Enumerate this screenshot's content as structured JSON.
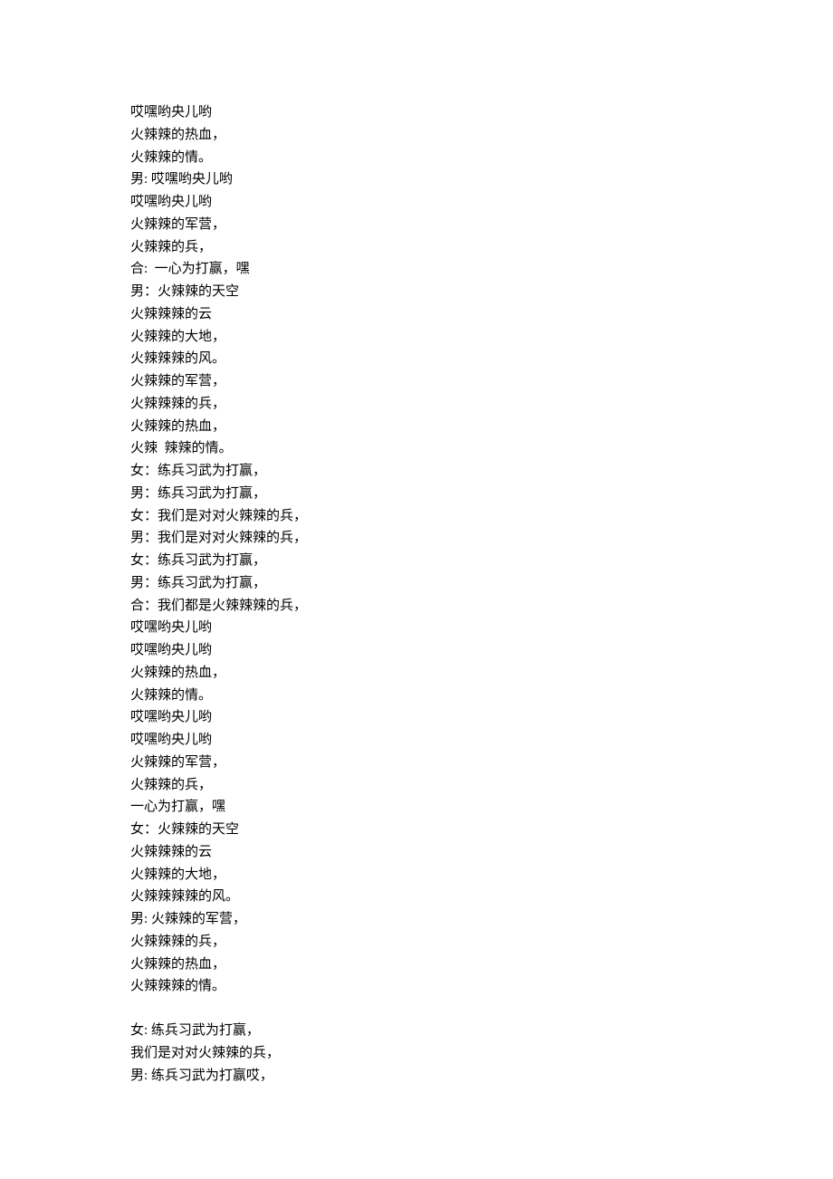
{
  "lines": [
    "哎嘿哟央儿哟",
    "火辣辣的热血，",
    "火辣辣的情。",
    "男: 哎嘿哟央儿哟",
    "哎嘿哟央儿哟",
    "火辣辣的军营，",
    "火辣辣的兵，",
    "合:  一心为打赢，嘿",
    "男：火辣辣的天空",
    "火辣辣辣的云",
    "火辣辣的大地，",
    "火辣辣辣的风。",
    "火辣辣的军营，",
    "火辣辣辣的兵，",
    "火辣辣的热血，",
    "火辣  辣辣的情。",
    "女：练兵习武为打赢，",
    "男：练兵习武为打赢，",
    "女：我们是对对火辣辣的兵，",
    "男：我们是对对火辣辣的兵，",
    "女：练兵习武为打赢，",
    "男：练兵习武为打赢，",
    "合：我们都是火辣辣辣的兵，",
    "哎嘿哟央儿哟",
    "哎嘿哟央儿哟",
    "火辣辣的热血，",
    "火辣辣的情。",
    "哎嘿哟央儿哟",
    "哎嘿哟央儿哟",
    "火辣辣的军营，",
    "火辣辣的兵，",
    "一心为打赢，嘿",
    "女：火辣辣的天空",
    "火辣辣辣的云",
    "火辣辣的大地，",
    "火辣辣辣辣的风。",
    "男: 火辣辣的军营，",
    "火辣辣辣的兵，",
    "火辣辣的热血，",
    "火辣辣辣的情。",
    "",
    "女: 练兵习武为打赢，",
    "我们是对对火辣辣的兵，",
    "男: 练兵习武为打赢哎，"
  ]
}
